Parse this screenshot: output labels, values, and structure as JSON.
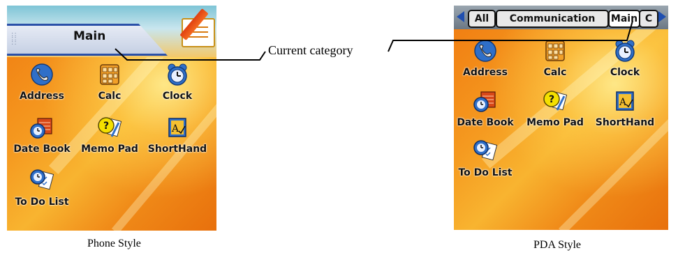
{
  "phone": {
    "title": "Main",
    "caption": "Phone Style",
    "apps": [
      {
        "label": "Address",
        "icon": "address-icon"
      },
      {
        "label": "Calc",
        "icon": "calc-icon"
      },
      {
        "label": "Clock",
        "icon": "clock-icon"
      },
      {
        "label": "Date Book",
        "icon": "datebook-icon"
      },
      {
        "label": "Memo Pad",
        "icon": "memopad-icon"
      },
      {
        "label": "ShortHand",
        "icon": "shorthand-icon"
      },
      {
        "label": "To Do List",
        "icon": "todolist-icon"
      }
    ]
  },
  "pda": {
    "caption": "PDA Style",
    "tabs": [
      {
        "label": "All",
        "active": false
      },
      {
        "label": "Communication",
        "active": false
      },
      {
        "label": "Main",
        "active": true
      },
      {
        "label": "C",
        "active": false
      }
    ],
    "apps": [
      {
        "label": "Address",
        "icon": "address-icon"
      },
      {
        "label": "Calc",
        "icon": "calc-icon"
      },
      {
        "label": "Clock",
        "icon": "clock-icon"
      },
      {
        "label": "Date Book",
        "icon": "datebook-icon"
      },
      {
        "label": "Memo Pad",
        "icon": "memopad-icon"
      },
      {
        "label": "ShortHand",
        "icon": "shorthand-icon"
      },
      {
        "label": "To Do List",
        "icon": "todolist-icon"
      }
    ]
  },
  "annotation": {
    "label": "Current category"
  },
  "colors": {
    "wallpaper": "#f59a20",
    "header_blue": "#2a50a8",
    "tab_bar": "#7f8a96",
    "arrow": "#1f4fb0"
  }
}
